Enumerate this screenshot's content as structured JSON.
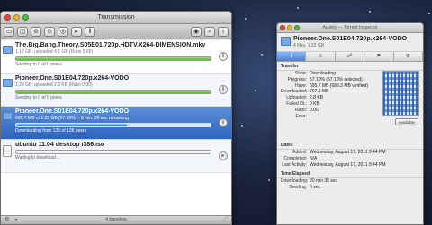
{
  "main_window": {
    "title": "Transmission",
    "toolbar": [
      {
        "name": "open-torrent-icon",
        "glyph": "▭"
      },
      {
        "name": "open-url-icon",
        "glyph": "◫"
      },
      {
        "name": "remove-icon",
        "glyph": "⊘"
      },
      {
        "name": "pause-all-icon",
        "glyph": "⊙"
      },
      {
        "name": "resume-all-icon",
        "glyph": "◎"
      },
      {
        "name": "resume-icon",
        "glyph": "▸"
      },
      {
        "name": "pause-icon",
        "glyph": "‖"
      },
      {
        "name": "quick-look-icon",
        "glyph": "◉"
      },
      {
        "name": "filter-icon",
        "glyph": "⌕"
      },
      {
        "name": "info-icon",
        "glyph": "i"
      }
    ],
    "torrents": [
      {
        "name": "The.Big.Bang.Theory.S05E01.720p.HDTV.X264-DIMENSION.mkv",
        "sub": "1.12 GB, uploaded 4.1 GB (Ratio 3.68)",
        "progress": 100,
        "status": "Seeding to 0 of 0 peers",
        "selected": false
      },
      {
        "name": "Pioneer.One.S01E04.720p.x264-VODO",
        "sub": "1.22 GB, uploaded 2.8 KB (Ratio 0.00)",
        "progress": 100,
        "status": "Seeding to 0 of 0 peers",
        "selected": false
      },
      {
        "name": "Pioneer.One.S01E04.720p.x264-VODO",
        "sub": "695.7 MB of 1.22 GB (57.10%) - 8 min, 26 sec remaining",
        "progress": 57,
        "status": "Downloading from 125 of 128 peers",
        "selected": true
      },
      {
        "name": "ubuntu 11.04 desktop i386.iso",
        "sub": "",
        "progress": 0,
        "status": "Waiting to download...",
        "selected": false
      }
    ],
    "statusbar": "4 transfers"
  },
  "inspector": {
    "title": "Activity — Torrent Inspector",
    "name": "Pioneer.One.S01E04.720p.x264-VODO",
    "sub": "4 files, 1.22 GB",
    "tabs": [
      "i",
      "≡",
      "☍",
      "⚑",
      "⚙"
    ],
    "transfer": {
      "heading": "Transfer",
      "rows": [
        {
          "k": "State:",
          "v": "Downloading"
        },
        {
          "k": "Progress:",
          "v": "57.10% (57.10% selected)"
        },
        {
          "k": "Have:",
          "v": "695.7 MB (688.3 MB verified)"
        },
        {
          "k": "Downloaded:",
          "v": "707.1 MB"
        },
        {
          "k": "Uploaded:",
          "v": "2.8 KB"
        },
        {
          "k": "Failed DL:",
          "v": "0 KB"
        },
        {
          "k": "Ratio:",
          "v": "0.00"
        },
        {
          "k": "Error:",
          "v": ""
        }
      ],
      "pieces_button": "Available"
    },
    "dates": {
      "heading": "Dates",
      "rows": [
        {
          "k": "Added:",
          "v": "Wednesday, August 17, 2011 9:44 PM"
        },
        {
          "k": "Completed:",
          "v": "N/A"
        },
        {
          "k": "Last Activity:",
          "v": "Wednesday, August 17, 2011 9:44 PM"
        }
      ]
    },
    "elapsed": {
      "heading": "Time Elapsed",
      "rows": [
        {
          "k": "Downloading:",
          "v": "20 min 35 sec"
        },
        {
          "k": "Seeding:",
          "v": "0 sec"
        }
      ]
    }
  }
}
